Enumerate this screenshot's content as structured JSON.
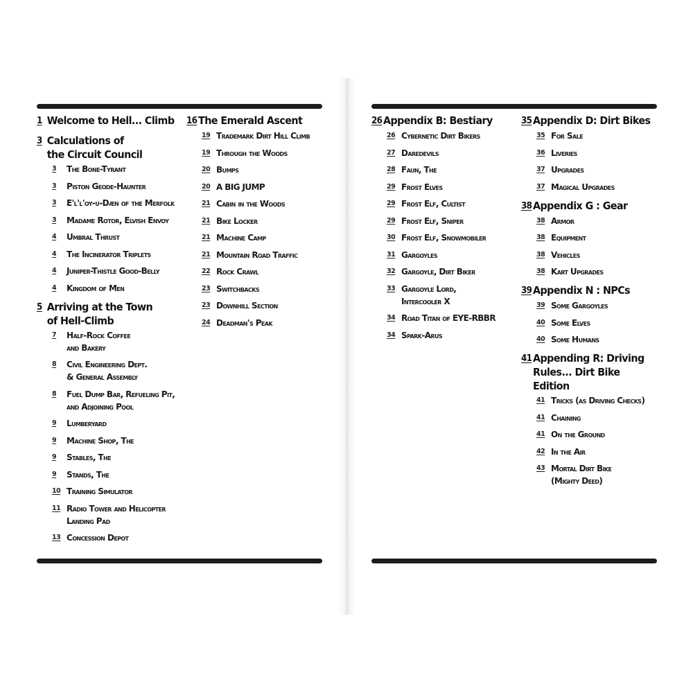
{
  "left_page": {
    "columns": [
      {
        "sections": [
          {
            "page": "1",
            "title": "Welcome to Hell... Climb",
            "entries": []
          },
          {
            "page": "3",
            "title": "Calculations of\nthe Circuit Council",
            "entries": [
              {
                "page": "3",
                "title": "The Bone-Tyrant"
              },
              {
                "page": "3",
                "title": "Piston Geode-Haunter"
              },
              {
                "page": "3",
                "title": "E'l'l'oy-u-Dæn of the Merfolk"
              },
              {
                "page": "3",
                "title": "Madame Rotor, Elvish Envoy"
              },
              {
                "page": "4",
                "title": "Umbral Thrust"
              },
              {
                "page": "4",
                "title": "The Incinerator Triplets"
              },
              {
                "page": "4",
                "title": "Juniper-Thistle Good-Belly"
              },
              {
                "page": "4",
                "title": "Kingdom of Men"
              }
            ]
          },
          {
            "page": "5",
            "title": "Arriving at the Town\nof Hell-Climb",
            "entries": [
              {
                "page": "7",
                "title": "Half-Rock Coffee\nand Bakery"
              },
              {
                "page": "8",
                "title": "Civil Engineering Dept.\n& General Assembly"
              },
              {
                "page": "8",
                "title": "Fuel Dump Bar, Refueling Pit,\nand Adjoining Pool"
              },
              {
                "page": "9",
                "title": "Lumberyard"
              },
              {
                "page": "9",
                "title": "Machine Shop, The"
              },
              {
                "page": "9",
                "title": "Stables, The"
              },
              {
                "page": "9",
                "title": "Stands, The"
              },
              {
                "page": "10",
                "title": "Training Simulator"
              },
              {
                "page": "11",
                "title": "Radio Tower and Helicopter\nLanding Pad"
              },
              {
                "page": "13",
                "title": "Concession Depot"
              }
            ]
          }
        ]
      },
      {
        "sections": [
          {
            "page": "16",
            "title": "The Emerald Ascent",
            "entries": [
              {
                "page": "19",
                "title": "Trademark Dirt Hill Climb"
              },
              {
                "page": "19",
                "title": "Through the Woods"
              },
              {
                "page": "20",
                "title": "Bumps"
              },
              {
                "page": "20",
                "title": "A BIG JUMP"
              },
              {
                "page": "21",
                "title": "Cabin in the Woods"
              },
              {
                "page": "21",
                "title": "Bike Locker"
              },
              {
                "page": "21",
                "title": "Machine Camp"
              },
              {
                "page": "21",
                "title": "Mountain Road Traffic"
              },
              {
                "page": "22",
                "title": "Rock Crawl"
              },
              {
                "page": "23",
                "title": "Switchbacks"
              },
              {
                "page": "23",
                "title": "Downhill Section"
              },
              {
                "page": "24",
                "title": "Deadman's Peak"
              }
            ]
          }
        ]
      }
    ]
  },
  "right_page": {
    "columns": [
      {
        "sections": [
          {
            "page": "26",
            "title": "Appendix B: Bestiary",
            "entries": [
              {
                "page": "26",
                "title": "Cybernetic Dirt Bikers"
              },
              {
                "page": "27",
                "title": "Daredevils"
              },
              {
                "page": "28",
                "title": "Faun, The"
              },
              {
                "page": "29",
                "title": "Frost Elves"
              },
              {
                "page": "29",
                "title": "Frost Elf, Cultist"
              },
              {
                "page": "29",
                "title": "Frost Elf, Sniper"
              },
              {
                "page": "30",
                "title": "Frost Elf, Snowmobiler"
              },
              {
                "page": "31",
                "title": "Gargoyles"
              },
              {
                "page": "32",
                "title": "Gargoyle, Dirt Biker"
              },
              {
                "page": "33",
                "title": "Gargoyle Lord,\nIntercooler X"
              },
              {
                "page": "34",
                "title": "Road Titan of EYE-RBBR"
              },
              {
                "page": "34",
                "title": "Spark-Arus"
              }
            ]
          }
        ]
      },
      {
        "sections": [
          {
            "page": "35",
            "title": "Appendix D: Dirt Bikes",
            "entries": [
              {
                "page": "35",
                "title": "For Sale"
              },
              {
                "page": "36",
                "title": "Liveries"
              },
              {
                "page": "37",
                "title": "Upgrades"
              },
              {
                "page": "37",
                "title": "Magical Upgrades"
              }
            ]
          },
          {
            "page": "38",
            "title": "Appendix G : Gear",
            "entries": [
              {
                "page": "38",
                "title": "Armor"
              },
              {
                "page": "38",
                "title": "Equipment"
              },
              {
                "page": "38",
                "title": "Vehicles"
              },
              {
                "page": "38",
                "title": "Kart Upgrades"
              }
            ]
          },
          {
            "page": "39",
            "title": "Appendix N : NPCs",
            "entries": [
              {
                "page": "39",
                "title": "Some Gargoyles"
              },
              {
                "page": "40",
                "title": "Some Elves"
              },
              {
                "page": "40",
                "title": "Some Humans"
              }
            ]
          },
          {
            "page": "41",
            "title": "Appending R: Driving\nRules... Dirt Bike Edition",
            "entries": [
              {
                "page": "41",
                "title": "Tricks (as Driving Checks)"
              },
              {
                "page": "41",
                "title": "Chaining"
              },
              {
                "page": "41",
                "title": "On the Ground"
              },
              {
                "page": "42",
                "title": "In the Air"
              },
              {
                "page": "43",
                "title": "Mortal Dirt Bike\n(Mighty Deed)"
              }
            ]
          }
        ]
      }
    ]
  }
}
